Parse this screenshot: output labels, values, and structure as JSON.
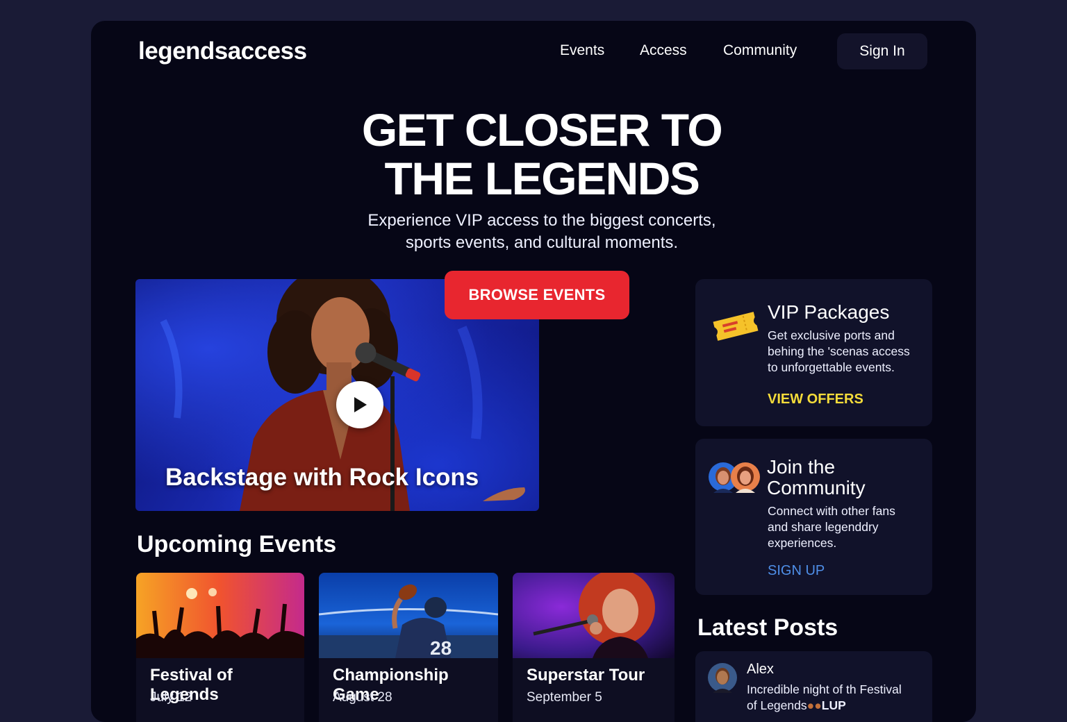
{
  "header": {
    "logo": "legendsaccess",
    "nav": [
      "Events",
      "Access",
      "Community"
    ],
    "sign_in": "Sign In"
  },
  "hero": {
    "title_line1": "GET CLOSER TO",
    "title_line2": "THE LEGENDS",
    "subtitle_line1": "Experience VIP access to the biggest concerts,",
    "subtitle_line2": "sports events, and cultural moments.",
    "cta": "BROWSE EVENTS"
  },
  "featured_video": {
    "title": "Backstage with Rock Icons"
  },
  "upcoming": {
    "heading": "Upcoming Events",
    "events": [
      {
        "name": "Festival of Legends",
        "date": "July 12"
      },
      {
        "name": "Championship Game",
        "date": "August 28"
      },
      {
        "name": "Superstar Tour",
        "date": "September 5"
      }
    ]
  },
  "vip": {
    "title": "VIP Packages",
    "text_line1": "Get exclusive ports and",
    "text_line2": "behing the 'scenas access",
    "text_line3": "to unforgettable events.",
    "link": "VIEW OFFERS"
  },
  "community": {
    "title_line1": "Join the",
    "title_line2": "Community",
    "text_line1": "Connect with other fans",
    "text_line2": "and share legenddry",
    "text_line3": "experiences.",
    "link": "SIGN UP"
  },
  "latest_posts": {
    "heading": "Latest Posts",
    "posts": [
      {
        "author": "Alex",
        "text_line1": "Incredible night of th Festival",
        "text_line2": "of Legends",
        "text_tail": "LUP"
      }
    ]
  },
  "colors": {
    "page_bg": "#1a1b36",
    "frame_bg": "#060616",
    "cta_red": "#e8262f",
    "vip_link_yellow": "#f5dc3a",
    "community_link_blue": "#4f8fe8",
    "card_bg": "#11122a"
  },
  "icons": [
    "play-icon",
    "ticket-icon",
    "avatar-icon"
  ]
}
